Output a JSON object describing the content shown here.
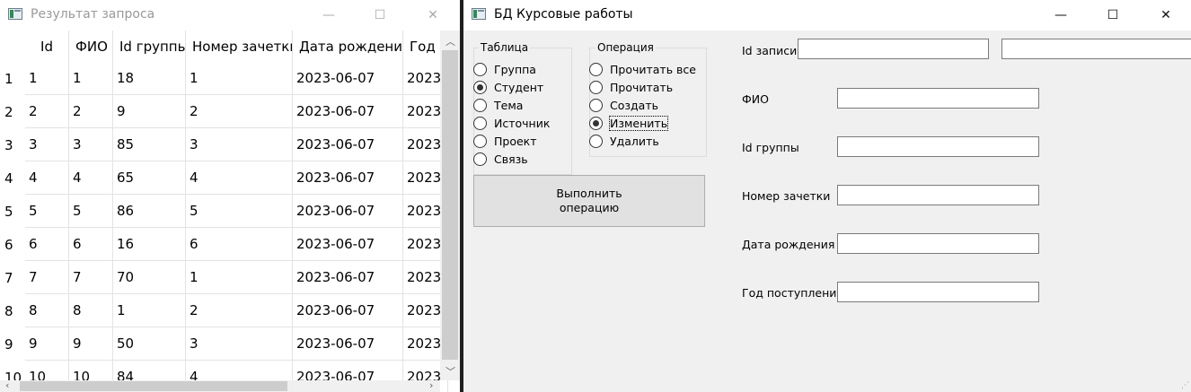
{
  "result_window": {
    "title": "Результат запроса",
    "controls": {
      "minimize": "—",
      "maximize": "☐",
      "close": "✕"
    },
    "columns": [
      "Id",
      "ФИО",
      "Id группы",
      "Номер зачетки",
      "Дата рождения",
      "Год поступления"
    ],
    "columns_visible_text": [
      "Id",
      "ФИО",
      "Id группы",
      "Номер зачетки",
      "Дата рождения",
      "Год г"
    ],
    "rows": [
      {
        "num": "1",
        "cells": [
          "1",
          "1",
          "18",
          "1",
          "2023-06-07",
          "2023"
        ]
      },
      {
        "num": "2",
        "cells": [
          "2",
          "2",
          "9",
          "2",
          "2023-06-07",
          "2023"
        ]
      },
      {
        "num": "3",
        "cells": [
          "3",
          "3",
          "85",
          "3",
          "2023-06-07",
          "2023"
        ]
      },
      {
        "num": "4",
        "cells": [
          "4",
          "4",
          "65",
          "4",
          "2023-06-07",
          "2023"
        ]
      },
      {
        "num": "5",
        "cells": [
          "5",
          "5",
          "86",
          "5",
          "2023-06-07",
          "2023"
        ]
      },
      {
        "num": "6",
        "cells": [
          "6",
          "6",
          "16",
          "6",
          "2023-06-07",
          "2023"
        ]
      },
      {
        "num": "7",
        "cells": [
          "7",
          "7",
          "70",
          "1",
          "2023-06-07",
          "2023"
        ]
      },
      {
        "num": "8",
        "cells": [
          "8",
          "8",
          "1",
          "2",
          "2023-06-07",
          "2023"
        ]
      },
      {
        "num": "9",
        "cells": [
          "9",
          "9",
          "50",
          "3",
          "2023-06-07",
          "2023"
        ]
      },
      {
        "num": "10",
        "cells": [
          "10",
          "10",
          "84",
          "4",
          "2023-06-07",
          "2023"
        ]
      }
    ]
  },
  "main_window": {
    "title": "БД Курсовые работы",
    "controls": {
      "minimize": "—",
      "maximize": "☐",
      "close": "✕"
    },
    "table_group": {
      "label": "Таблица",
      "options": [
        {
          "label": "Группа",
          "checked": false
        },
        {
          "label": "Студент",
          "checked": true
        },
        {
          "label": "Тема",
          "checked": false
        },
        {
          "label": "Источник",
          "checked": false
        },
        {
          "label": "Проект",
          "checked": false
        },
        {
          "label": "Связь",
          "checked": false
        }
      ]
    },
    "operation_group": {
      "label": "Операция",
      "options": [
        {
          "label": "Прочитать все",
          "checked": false
        },
        {
          "label": "Прочитать",
          "checked": false
        },
        {
          "label": "Создать",
          "checked": false
        },
        {
          "label": "Изменить",
          "checked": true
        },
        {
          "label": "Удалить",
          "checked": false
        }
      ]
    },
    "execute_button": "Выполнить\nоперацию",
    "form": {
      "record_id_label": "Id записи",
      "record_id_value": "",
      "record_id_extra_value": "",
      "fio_label": "ФИО",
      "fio_value": "",
      "group_id_label": "Id группы",
      "group_id_value": "",
      "record_book_label": "Номер зачетки",
      "record_book_value": "",
      "birth_date_label": "Дата рождения",
      "birth_date_value": "",
      "enroll_year_label": "Год поступления",
      "enroll_year_value": ""
    }
  }
}
